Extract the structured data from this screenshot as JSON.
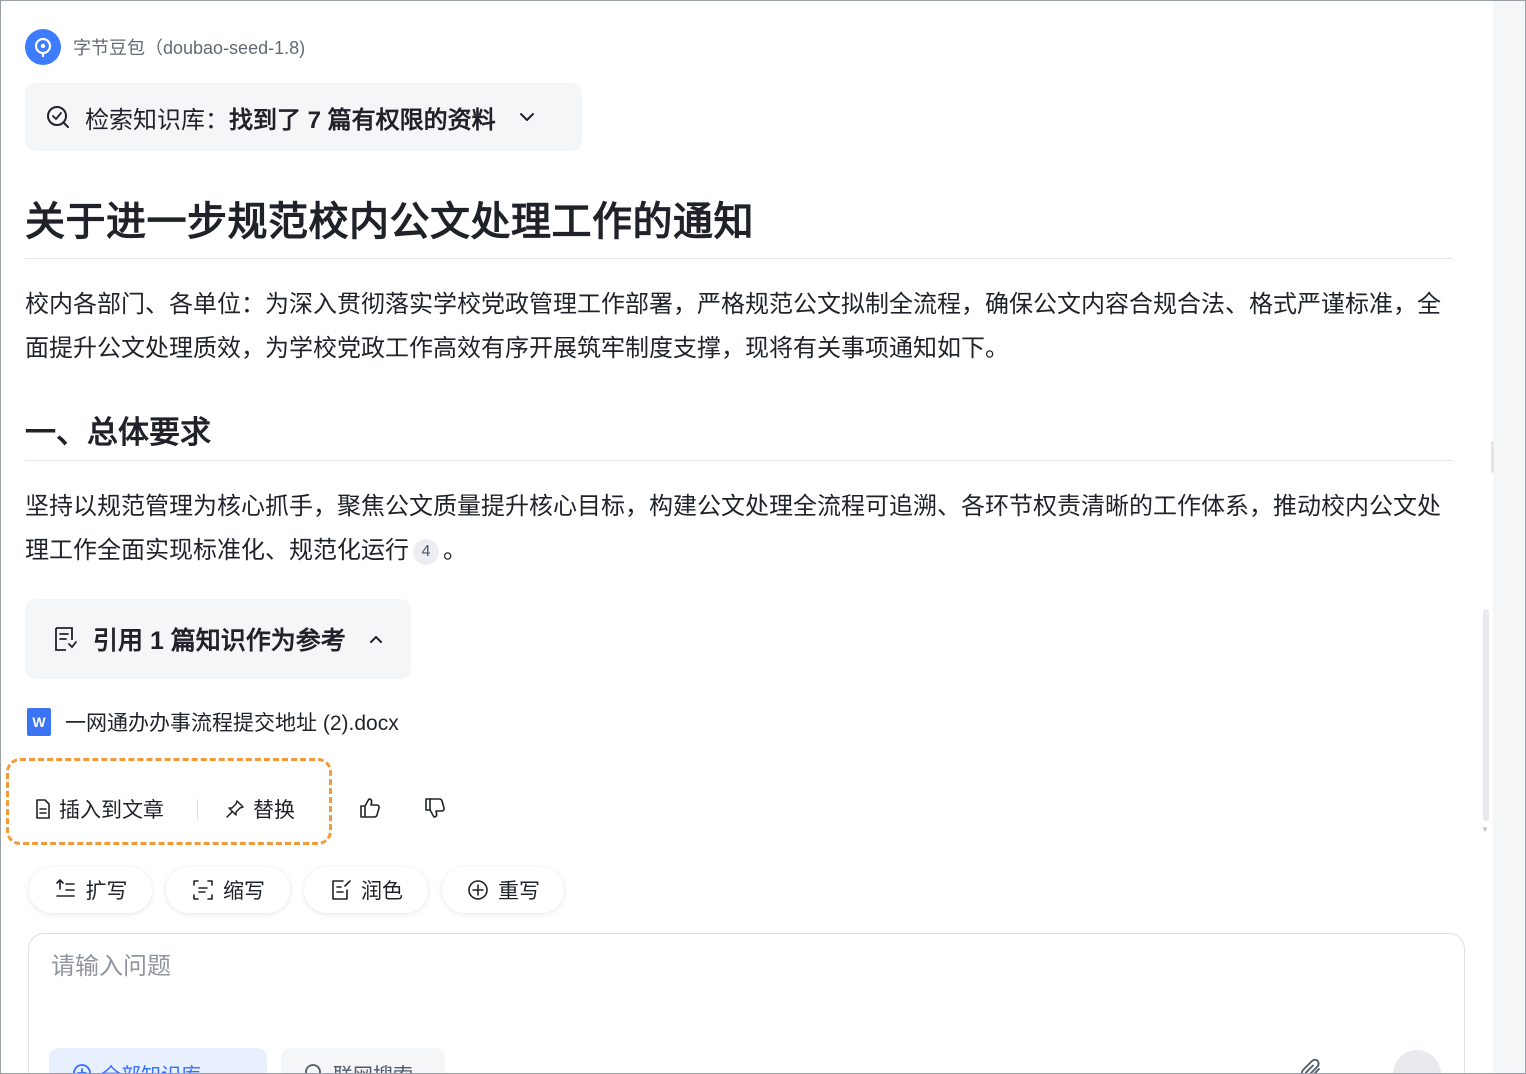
{
  "model": {
    "name": "字节豆包（doubao-seed-1.8)"
  },
  "knowledge_search": {
    "label": "检索知识库：",
    "result": "找到了 7 篇有权限的资料"
  },
  "article": {
    "title": "关于进一步规范校内公文处理工作的通知",
    "intro": "校内各部门、各单位：为深入贯彻落实学校党政管理工作部署，严格规范公文拟制全流程，确保公文内容合规合法、格式严谨标准，全面提升公文处理质效，为学校党政工作高效有序开展筑牢制度支撑，现将有关事项通知如下。",
    "section1_heading": "一、总体要求",
    "section1_body": "坚持以规范管理为核心抓手，聚焦公文质量提升核心目标，构建公文处理全流程可追溯、各环节权责清晰的工作体系，推动校内公文处理工作全面实现标准化、规范化运行",
    "section1_citation": "4",
    "section1_end": "。"
  },
  "reference": {
    "label": "引用 1 篇知识作为参考",
    "file_name": "一网通办办事流程提交地址 (2).docx",
    "file_icon_letter": "W"
  },
  "actions": {
    "insert_label": "插入到文章",
    "replace_label": "替换"
  },
  "tools": {
    "expand_label": "扩写",
    "condense_label": "缩写",
    "polish_label": "润色",
    "rewrite_label": "重写"
  },
  "input": {
    "placeholder": "请输入问题",
    "value": ""
  },
  "bottom_bar": {
    "kb_chip_label": "全部知识库",
    "web_search_label": "联网搜索"
  },
  "colors": {
    "accent": "#3370ff",
    "highlight_border": "#f29a38",
    "word_blue": "#3a74f2"
  }
}
